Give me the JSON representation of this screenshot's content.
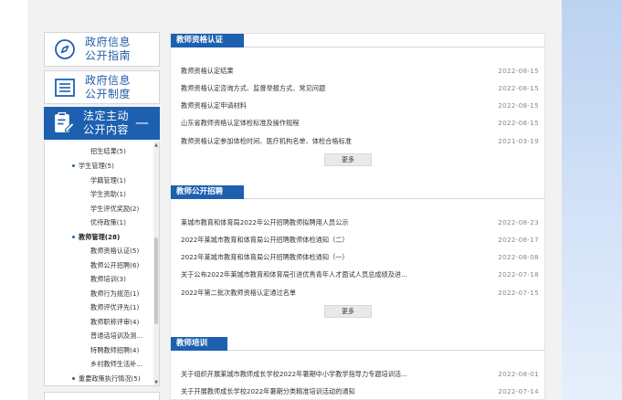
{
  "sidebar": {
    "guide": {
      "line1": "政府信息",
      "line2": "公开指南",
      "icon": "compass-icon"
    },
    "system": {
      "line1": "政府信息",
      "line2": "公开制度",
      "icon": "document-list-icon"
    },
    "active": {
      "line1": "法定主动",
      "line2": "公开内容",
      "toggle": "—",
      "icon": "clipboard-edit-icon"
    },
    "tree": [
      {
        "label": "招生结果(5)",
        "level": 2
      },
      {
        "label": "学生管理(5)",
        "level": 1
      },
      {
        "label": "学籍管理(1)",
        "level": 2
      },
      {
        "label": "学生资助(1)",
        "level": 2
      },
      {
        "label": "学生评优奖励(2)",
        "level": 2
      },
      {
        "label": "优待政策(1)",
        "level": 2
      },
      {
        "label": "教师管理(28)",
        "level": 1
      },
      {
        "label": "教师资格认证(5)",
        "level": 2
      },
      {
        "label": "教师公开招聘(6)",
        "level": 2
      },
      {
        "label": "教师培训(3)",
        "level": 2
      },
      {
        "label": "教师行为规范(1)",
        "level": 2
      },
      {
        "label": "教师评优评先(1)",
        "level": 2
      },
      {
        "label": "教师职称评审(4)",
        "level": 2
      },
      {
        "label": "普通话培训及测...",
        "level": 2
      },
      {
        "label": "特聘教师招聘(4)",
        "level": 2
      },
      {
        "label": "乡村教师生活补...",
        "level": 2
      },
      {
        "label": "重要政策执行情况(5)",
        "level": 1
      }
    ]
  },
  "sections": [
    {
      "title": "教师资格认证",
      "items": [
        {
          "title": "教师资格认定结果",
          "date": "2022-08-15"
        },
        {
          "title": "教师资格认定咨询方式、监督举报方式、常见问题",
          "date": "2022-08-15"
        },
        {
          "title": "教师资格认定申请材料",
          "date": "2022-08-15"
        },
        {
          "title": "山东省教师资格认定体检标准及操作规程",
          "date": "2022-08-15"
        },
        {
          "title": "教师资格认定参加体检时间、医疗机构名单、体检合格标准",
          "date": "2021-03-19"
        }
      ],
      "more": "更多"
    },
    {
      "title": "教师公开招聘",
      "items": [
        {
          "title": "莱城市教育和体育局2022年公开招聘教师拟聘用人员公示",
          "date": "2022-08-23"
        },
        {
          "title": "2022年莱城市教育和体育局公开招聘教师体检通知（二）",
          "date": "2022-08-17"
        },
        {
          "title": "2022年莱城市教育和体育局公开招聘教师体检通知（一）",
          "date": "2022-08-08"
        },
        {
          "title": "关于公布2022年莱城市教育和体育局引进优秀青年人才面试人员总成绩及进...",
          "date": "2022-07-18"
        },
        {
          "title": "2022年第二批次教师资格认定通过名单",
          "date": "2022-07-15"
        }
      ],
      "more": "更多"
    },
    {
      "title": "教师培训",
      "items": [
        {
          "title": "关于组织开展莱城市教师成长学校2022年暑期中小学教学指导力专题培训活...",
          "date": "2022-08-01"
        },
        {
          "title": "关于开展教师成长学校2022年暑期分类精准培训活动的通知",
          "date": "2022-07-14"
        }
      ]
    }
  ]
}
